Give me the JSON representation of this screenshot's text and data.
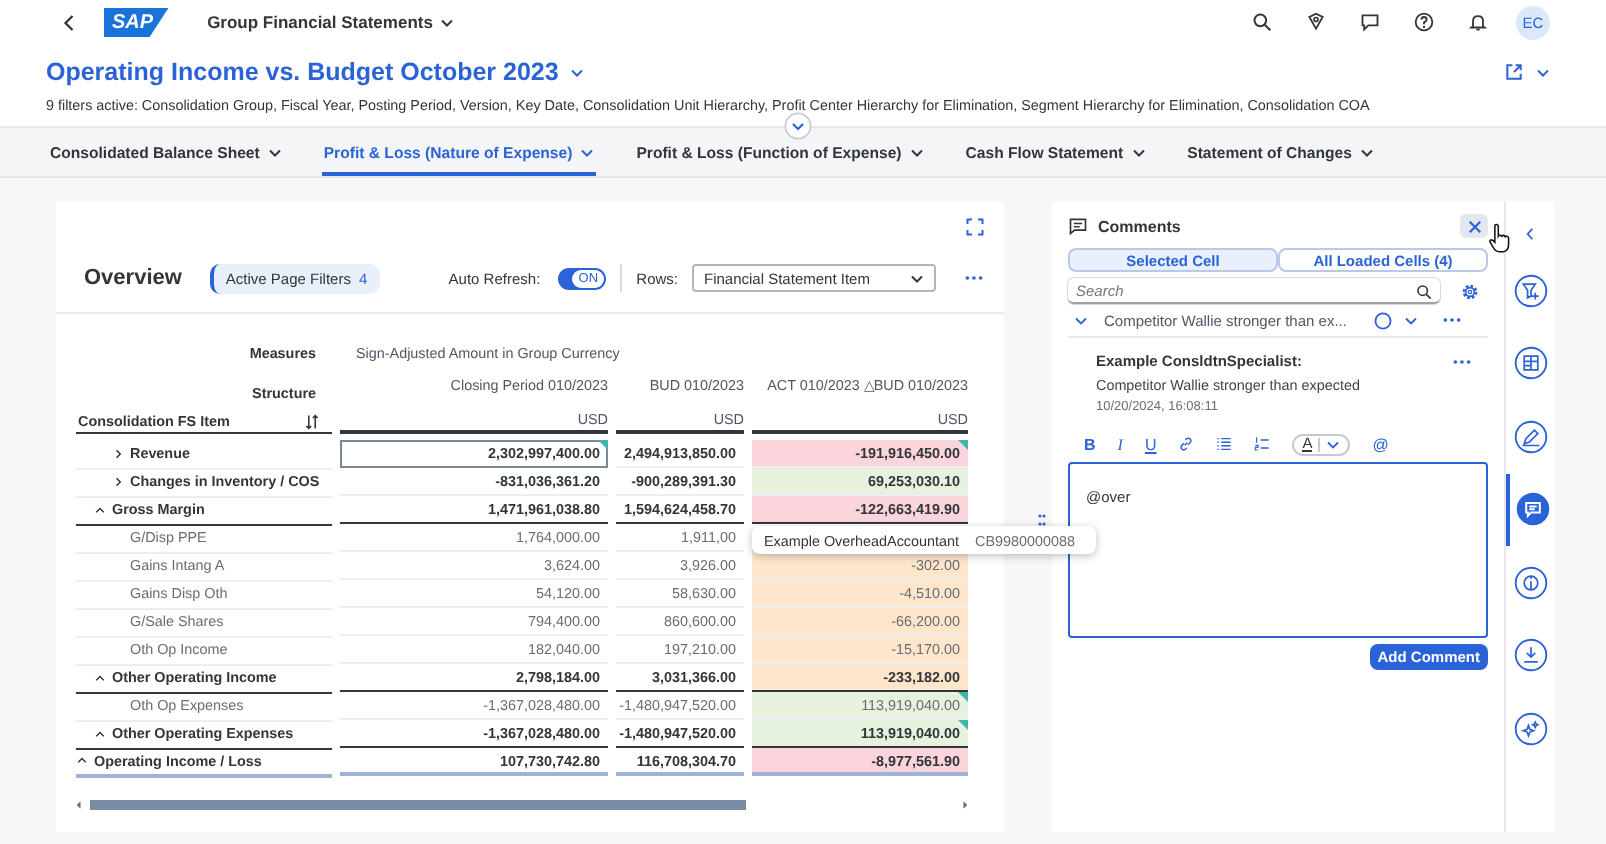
{
  "shell": {
    "logo": "SAP",
    "title": "Group Financial Statements",
    "avatar": "EC"
  },
  "header": {
    "title": "Operating Income vs. Budget October 2023",
    "filters": "9 filters active: Consolidation Group, Fiscal Year, Posting Period, Version, Key Date, Consolidation Unit Hierarchy, Profit Center Hierarchy for Elimination, Segment Hierarchy for Elimination, Consolidation COA"
  },
  "tabs": [
    {
      "label": "Consolidated Balance Sheet",
      "selected": false
    },
    {
      "label": "Profit & Loss (Nature of Expense)",
      "selected": true
    },
    {
      "label": "Profit & Loss (Function of Expense)",
      "selected": false
    },
    {
      "label": "Cash Flow Statement",
      "selected": false
    },
    {
      "label": "Statement of Changes",
      "selected": false
    }
  ],
  "toolbar": {
    "title": "Overview",
    "filters_button": {
      "label": "Active Page Filters",
      "count": "4"
    },
    "auto_refresh": {
      "label": "Auto Refresh:",
      "on": true,
      "text": "ON"
    },
    "rows_select": {
      "label": "Rows:",
      "value": "Financial Statement Item"
    }
  },
  "table": {
    "measures_label": "Measures",
    "measures": "Sign-Adjusted Amount in Group Currency",
    "structure_label": "Structure",
    "row_header": "Consolidation FS Item",
    "columns": [
      {
        "title": "Closing Period 010/2023",
        "unit": "USD"
      },
      {
        "title": "BUD 010/2023",
        "unit": "USD"
      },
      {
        "title": "ACT 010/2023 △BUD 010/2023",
        "unit": "USD"
      }
    ],
    "rows": [
      {
        "label": "Operating Income / Loss",
        "kind": "total",
        "expanded": true,
        "cells": [
          {
            "value": "107,730,742.80",
            "comment": false,
            "selected": false
          },
          {
            "value": "116,708,304.70",
            "comment": false,
            "selected": false
          },
          {
            "value": "-8,977,561.90",
            "color": "#fbd5dc",
            "comment": false,
            "selected": false
          }
        ],
        "children": [
          {
            "label": "Gross Margin",
            "kind": "total",
            "expanded": true,
            "cells": [
              {
                "value": "1,471,961,038.80",
                "comment": false,
                "selected": false
              },
              {
                "value": "1,594,624,458.70",
                "comment": false,
                "selected": false
              },
              {
                "value": "-122,663,419.90",
                "color": "#fbd5dc",
                "comment": false,
                "selected": false
              }
            ],
            "children": [
              {
                "label": "Revenue",
                "kind": "node",
                "expanded": false,
                "cells": [
                  {
                    "value": "2,302,997,400.00",
                    "comment": true,
                    "selected": true
                  },
                  {
                    "value": "2,494,913,850.00",
                    "comment": false,
                    "selected": false
                  },
                  {
                    "value": "-191,916,450.00",
                    "color": "#fbd5dc",
                    "comment": true,
                    "selected": false
                  }
                ]
              },
              {
                "label": "Changes in Inventory / COS",
                "kind": "node",
                "expanded": false,
                "cells": [
                  {
                    "value": "-831,036,361.20",
                    "comment": false,
                    "selected": false
                  },
                  {
                    "value": "-900,289,391.30",
                    "comment": false,
                    "selected": false
                  },
                  {
                    "value": "69,253,030.10",
                    "color": "#e6f2dd",
                    "comment": false,
                    "selected": false
                  }
                ]
              }
            ]
          },
          {
            "label": "Other Operating Income",
            "kind": "total",
            "expanded": true,
            "cells": [
              {
                "value": "2,798,184.00",
                "comment": false,
                "selected": false
              },
              {
                "value": "3,031,366.00",
                "comment": false,
                "selected": false
              },
              {
                "value": "-233,182.00",
                "color": "#fde6cc",
                "comment": false,
                "selected": false
              }
            ],
            "children": [
              {
                "label": "G/Disp PPE",
                "kind": "item",
                "cells": [
                  {
                    "value": "1,764,000.00",
                    "comment": false,
                    "selected": false
                  },
                  {
                    "value": "1,911,00",
                    "comment": false,
                    "selected": false
                  },
                  {
                    "comment": false,
                    "selected": false
                  }
                ]
              },
              {
                "label": "Gains Intang A",
                "kind": "item",
                "cells": [
                  {
                    "value": "3,624.00",
                    "comment": false,
                    "selected": false
                  },
                  {
                    "value": "3,926.00",
                    "comment": false,
                    "selected": false
                  },
                  {
                    "value": "-302.00",
                    "color": "#fde6cc",
                    "comment": false,
                    "selected": false
                  }
                ]
              },
              {
                "label": "Gains Disp Oth",
                "kind": "item",
                "cells": [
                  {
                    "value": "54,120.00",
                    "comment": false,
                    "selected": false
                  },
                  {
                    "value": "58,630.00",
                    "comment": false,
                    "selected": false
                  },
                  {
                    "value": "-4,510.00",
                    "color": "#fde6cc",
                    "comment": false,
                    "selected": false
                  }
                ]
              },
              {
                "label": "G/Sale Shares",
                "kind": "item",
                "cells": [
                  {
                    "value": "794,400.00",
                    "comment": false,
                    "selected": false
                  },
                  {
                    "value": "860,600.00",
                    "comment": false,
                    "selected": false
                  },
                  {
                    "value": "-66,200.00",
                    "color": "#fde6cc",
                    "comment": false,
                    "selected": false
                  }
                ]
              },
              {
                "label": "Oth Op Income",
                "kind": "item",
                "cells": [
                  {
                    "value": "182,040.00",
                    "comment": false,
                    "selected": false
                  },
                  {
                    "value": "197,210.00",
                    "comment": false,
                    "selected": false
                  },
                  {
                    "value": "-15,170.00",
                    "color": "#fde6cc",
                    "comment": false,
                    "selected": false
                  }
                ]
              }
            ]
          },
          {
            "label": "Other Operating Expenses",
            "kind": "total",
            "expanded": true,
            "cells": [
              {
                "value": "-1,367,028,480.00",
                "comment": false,
                "selected": false
              },
              {
                "value": "-1,480,947,520.00",
                "comment": false,
                "selected": false
              },
              {
                "value": "113,919,040.00",
                "color": "#e6f2dd",
                "comment": true,
                "selected": false
              }
            ],
            "children": [
              {
                "label": "Oth Op Expenses",
                "kind": "item",
                "cells": [
                  {
                    "value": "-1,367,028,480.00",
                    "comment": false,
                    "selected": false
                  },
                  {
                    "value": "-1,480,947,520.00",
                    "comment": false,
                    "selected": false
                  },
                  {
                    "value": "113,919,040.00",
                    "color": "#e6f2dd",
                    "comment": true,
                    "selected": false
                  }
                ]
              }
            ]
          }
        ]
      }
    ],
    "tooltip": {
      "name": "Example OverheadAccountant",
      "id": "CB9980000088"
    }
  },
  "comments": {
    "title": "Comments",
    "tabs": [
      {
        "label": "Selected Cell",
        "selected": true
      },
      {
        "label": "All Loaded Cells (4)",
        "selected": false
      }
    ],
    "search": {
      "placeholder": "Search"
    },
    "thread": {
      "subject": "Competitor Wallie stronger than ex...",
      "expanded": true
    },
    "entries": [
      {
        "author": "Example ConsldtnSpecialist:",
        "text": "Competitor Wallie stronger than expected",
        "time": "10/20/2024, 16:08:11"
      }
    ],
    "format_tools": [
      {
        "kind": "bold",
        "label": "B"
      },
      {
        "kind": "italic",
        "label": "I"
      },
      {
        "kind": "underline",
        "label": "U"
      },
      {
        "kind": "link"
      },
      {
        "kind": "bullets"
      },
      {
        "kind": "numbers"
      },
      {
        "kind": "color",
        "label": "A"
      },
      {
        "kind": "mention",
        "label": "@"
      }
    ],
    "editor": {
      "value": "@over"
    },
    "submit": "Add Comment"
  },
  "rail": [
    {
      "kind": "filter",
      "selected": false
    },
    {
      "kind": "table",
      "selected": false
    },
    {
      "kind": "pen",
      "selected": false
    },
    {
      "kind": "comments",
      "selected": true
    },
    {
      "kind": "info",
      "selected": false
    },
    {
      "kind": "download",
      "selected": false
    },
    {
      "kind": "sparkle",
      "selected": false
    }
  ]
}
